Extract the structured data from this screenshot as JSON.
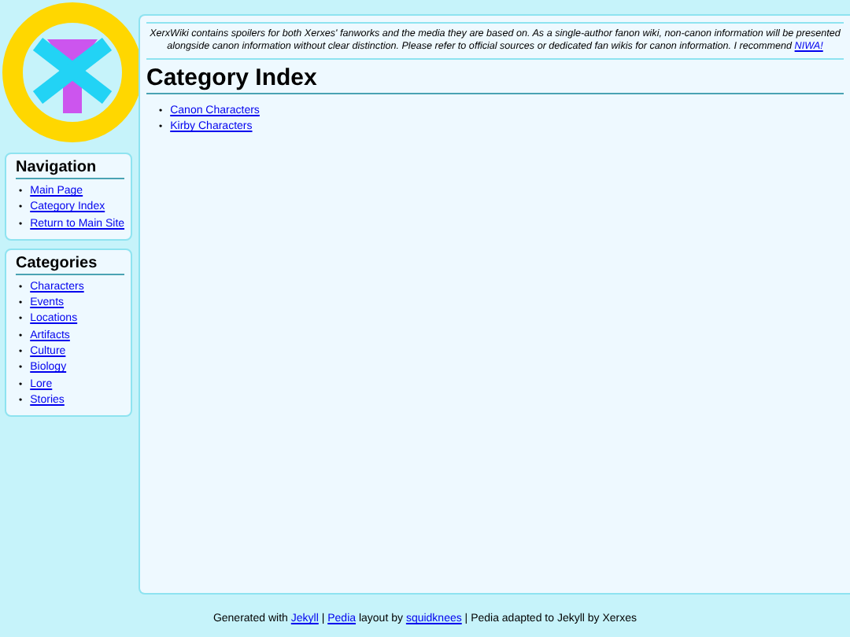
{
  "notice": {
    "text": "XerxWiki contains spoilers for both Xerxes' fanworks and the media they are based on. As a single-author fanon wiki, non-canon information will be presented alongside canon information without clear distinction. Please refer to official sources or dedicated fan wikis for canon information. I recommend ",
    "link": "NIWA!"
  },
  "bullet": "•",
  "page": {
    "title": "Category Index",
    "links": [
      "Canon Characters",
      "Kirby Characters"
    ]
  },
  "sidebar": [
    {
      "title": "Navigation",
      "links": [
        "Main Page",
        "Category Index",
        "Return to Main Site"
      ]
    },
    {
      "title": "Categories",
      "links": [
        "Characters",
        "Events",
        "Locations",
        "Artifacts",
        "Culture",
        "Biology",
        "Lore",
        "Stories"
      ]
    }
  ],
  "footer": [
    {
      "text": "Generated with ",
      "link": false
    },
    {
      "text": "Jekyll",
      "link": true
    },
    {
      "text": " | ",
      "link": false
    },
    {
      "text": "Pedia",
      "link": true
    },
    {
      "text": " layout by ",
      "link": false
    },
    {
      "text": "squidknees",
      "link": true
    },
    {
      "text": " | Pedia adapted to Jekyll by Xerxes",
      "link": false
    }
  ]
}
